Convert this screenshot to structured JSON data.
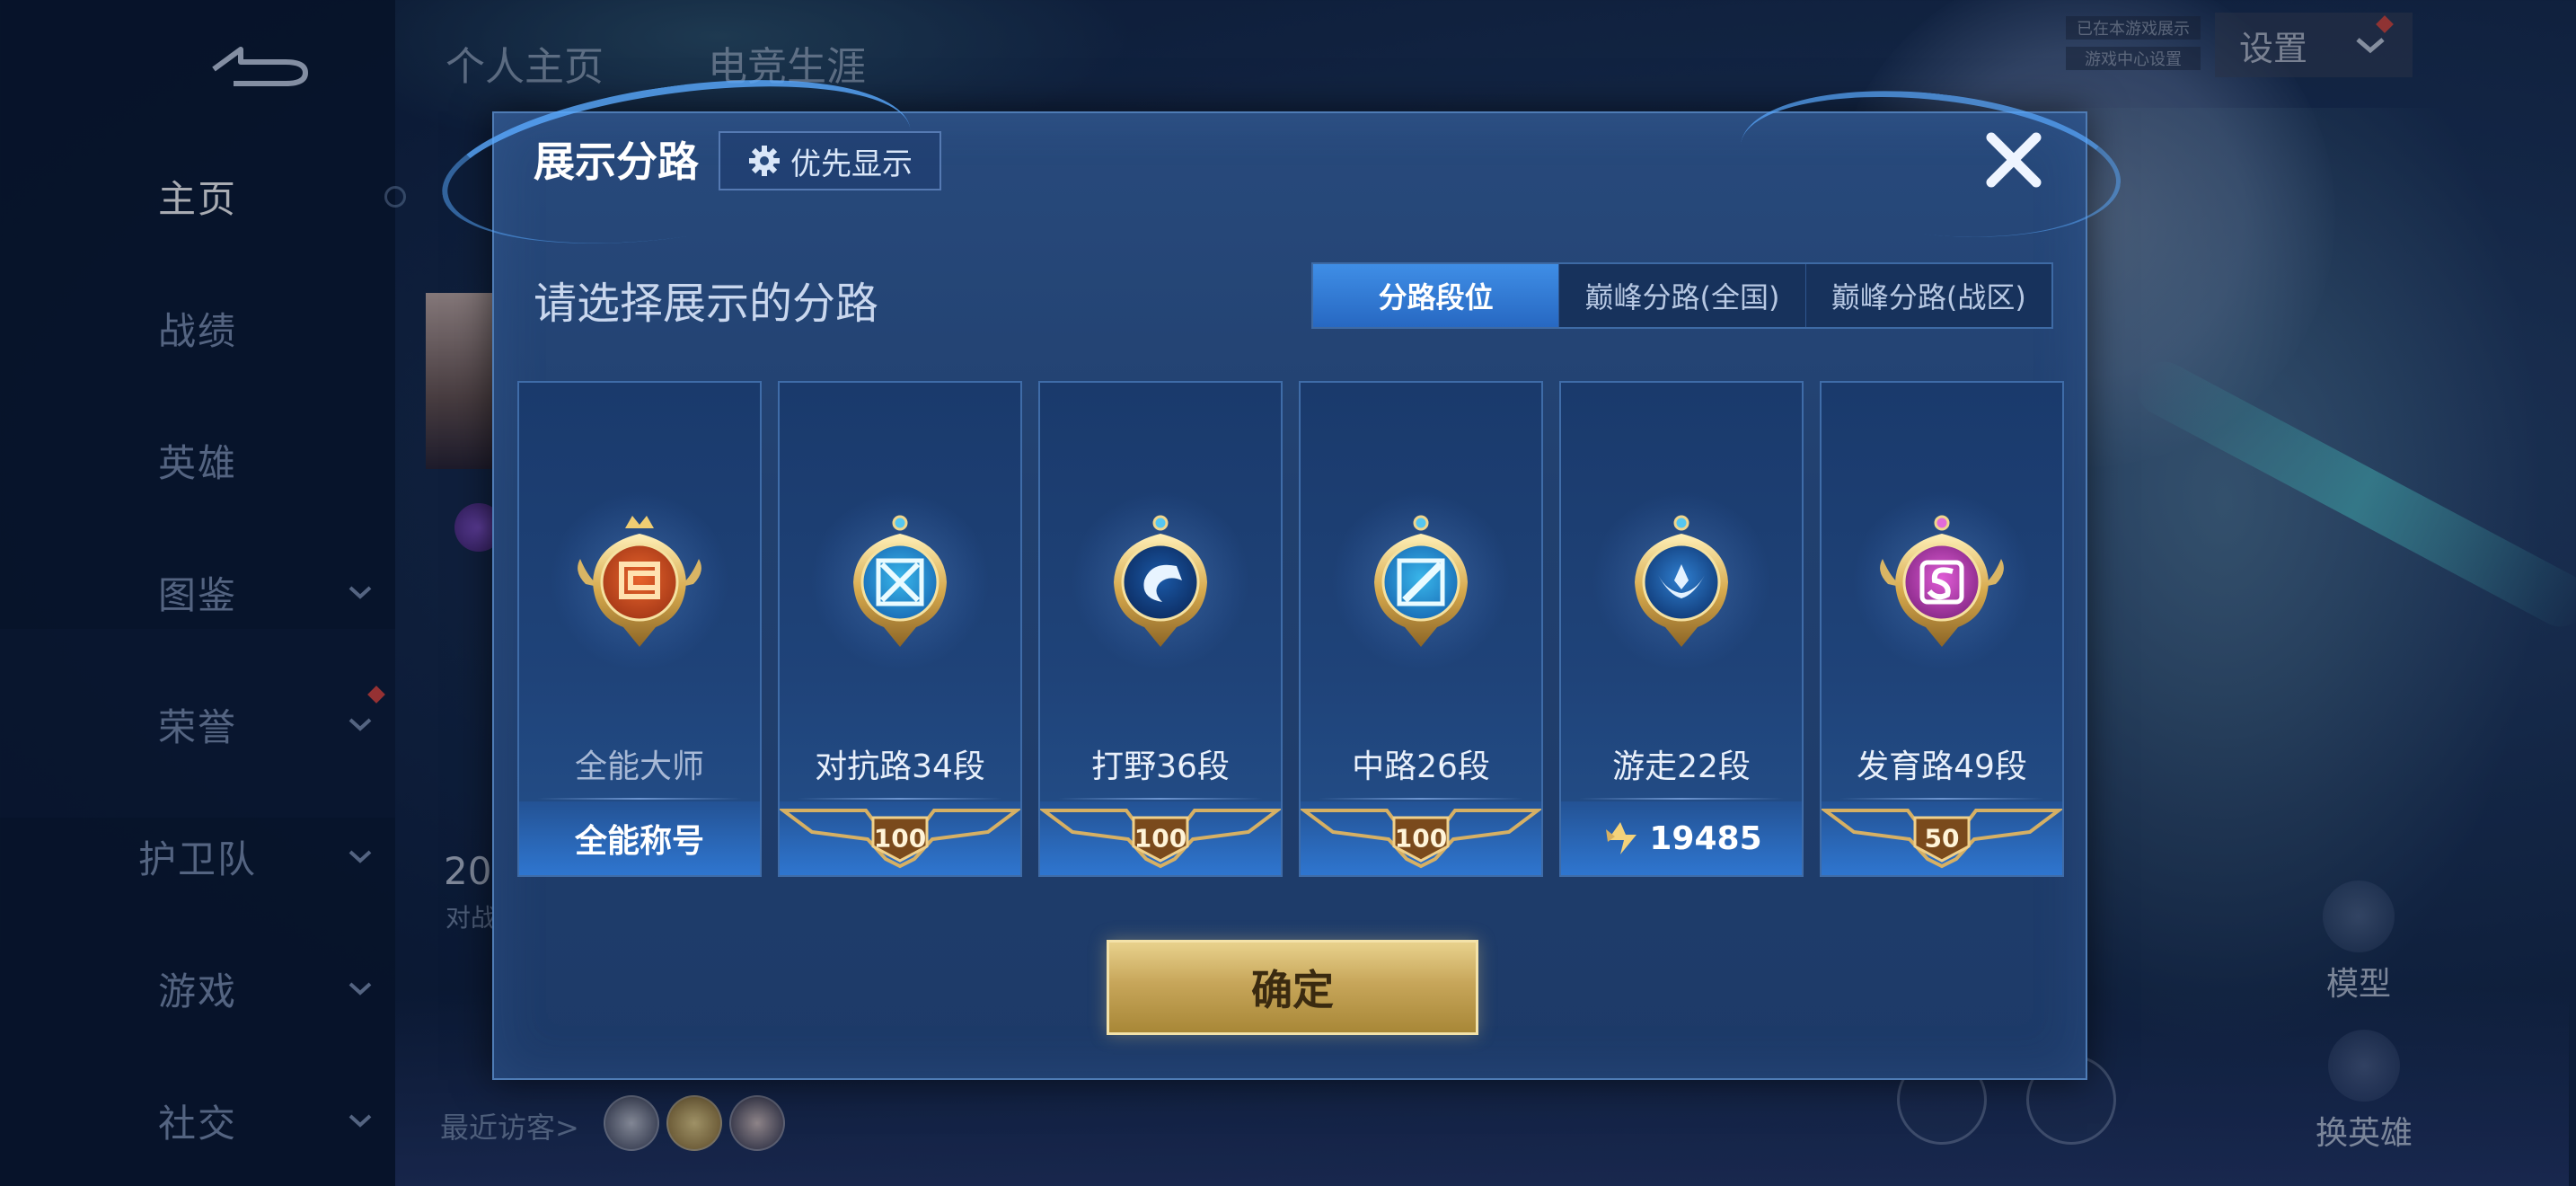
{
  "sidebar": {
    "items": [
      {
        "label": "主页",
        "has_chevron": false
      },
      {
        "label": "战绩",
        "has_chevron": false
      },
      {
        "label": "英雄",
        "has_chevron": false
      },
      {
        "label": "图鉴",
        "has_chevron": true
      },
      {
        "label": "荣誉",
        "has_chevron": true
      },
      {
        "label": "护卫队",
        "has_chevron": true
      },
      {
        "label": "游戏",
        "has_chevron": true
      },
      {
        "label": "社交",
        "has_chevron": true
      }
    ]
  },
  "top_tabs": [
    "个人主页",
    "电竞生涯"
  ],
  "settings_label": "设置",
  "small_tags": [
    "已在本游戏展示",
    "游戏中心设置"
  ],
  "behind": {
    "stat_value": "20",
    "stat_caption": "对战",
    "recent_visitors_label": "最近访客>",
    "model_label": "模型",
    "switch_hero_label": "换英雄"
  },
  "modal": {
    "title": "展示分路",
    "priority_button": "优先显示",
    "subtitle": "请选择展示的分路",
    "tabs": [
      "分路段位",
      "巅峰分路(全国)",
      "巅峰分路(战区)"
    ],
    "active_tab": 0,
    "cards": [
      {
        "name": "全能大师",
        "footer_text": "全能称号",
        "footer_type": "text"
      },
      {
        "name": "对抗路34段",
        "footer_text": "100",
        "footer_type": "badge"
      },
      {
        "name": "打野36段",
        "footer_text": "100",
        "footer_type": "badge"
      },
      {
        "name": "中路26段",
        "footer_text": "100",
        "footer_type": "badge"
      },
      {
        "name": "游走22段",
        "footer_text": "19485",
        "footer_type": "score"
      },
      {
        "name": "发育路49段",
        "footer_text": "50",
        "footer_type": "badge"
      }
    ],
    "confirm": "确定"
  },
  "colors": {
    "accent_blue": "#2f7ad8",
    "gold": "#c7a65a",
    "card_bg": "#1f4379"
  },
  "icons": [
    "back-arrow-icon",
    "chevron-down-icon",
    "gear-icon",
    "close-icon",
    "lane-emblem-icon",
    "peak-score-icon"
  ]
}
